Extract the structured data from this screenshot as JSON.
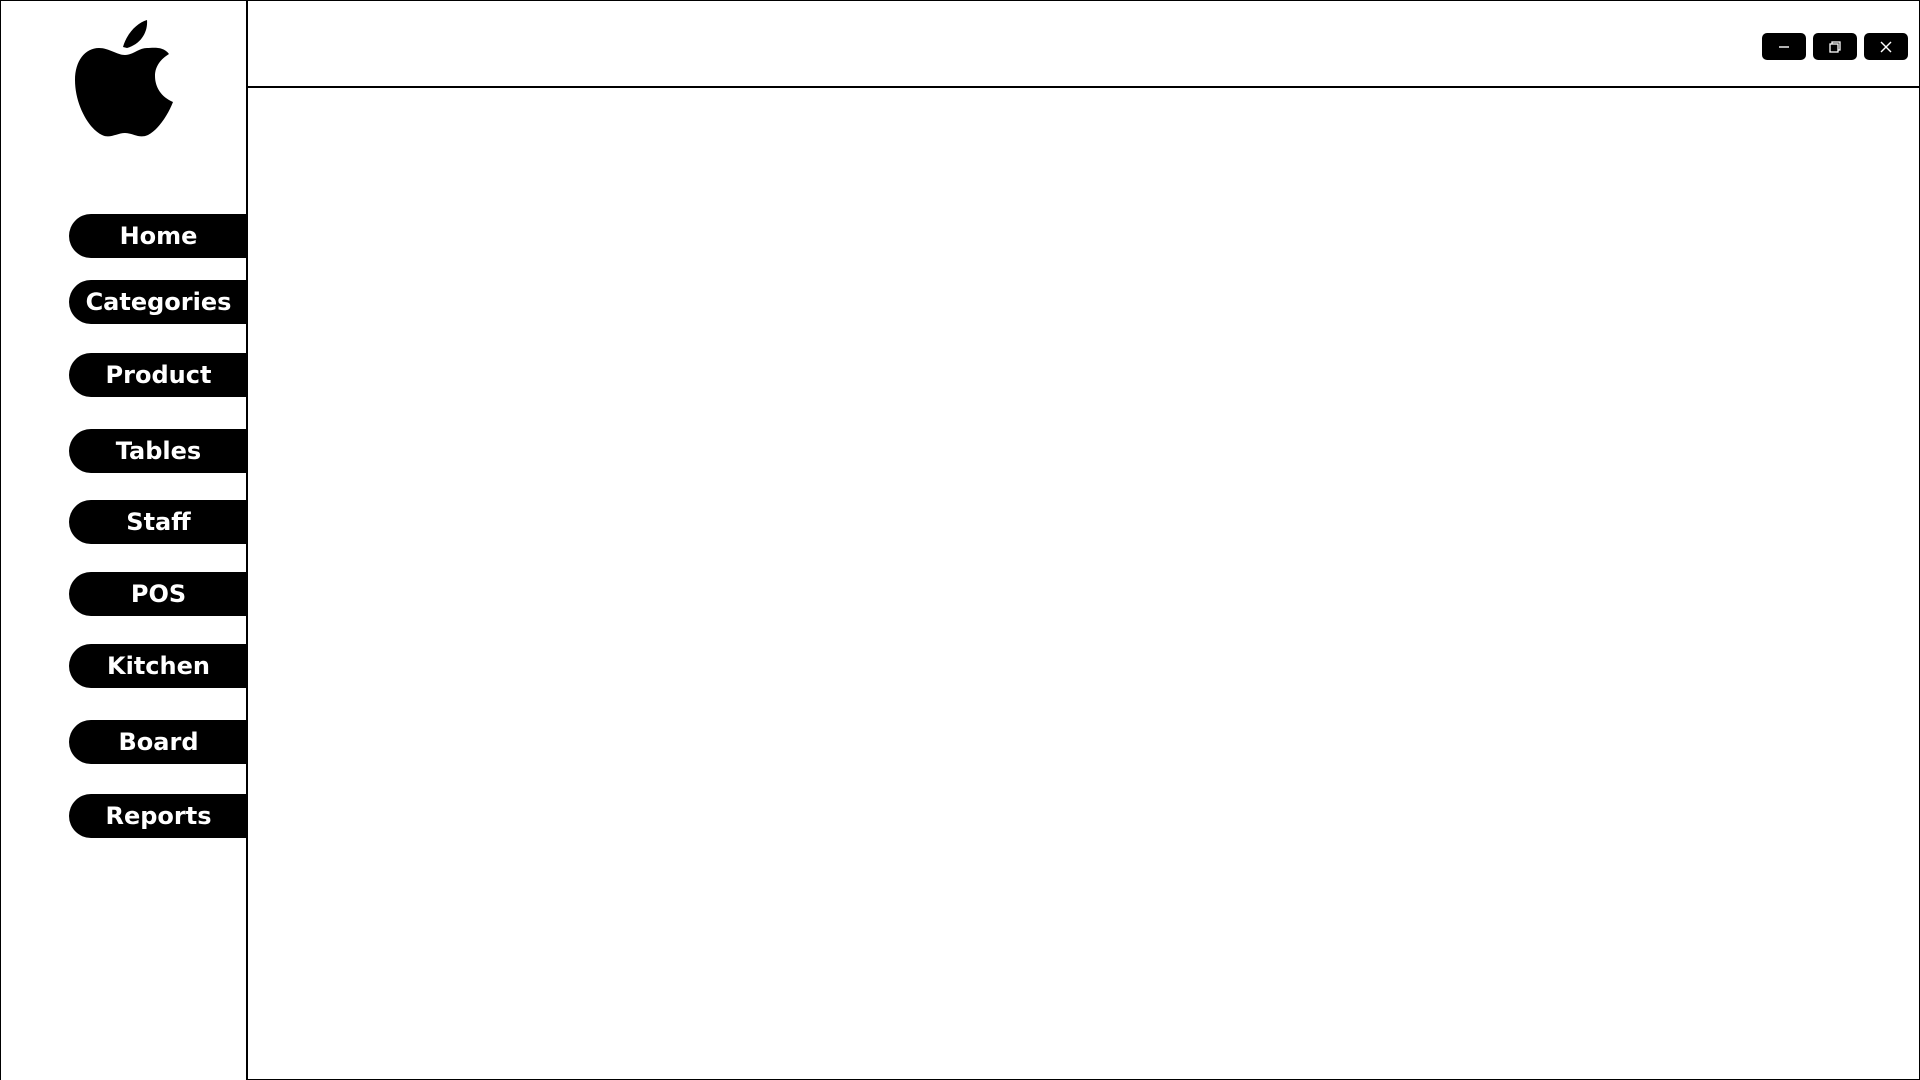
{
  "app": {
    "logo_icon": "apple-logo-icon"
  },
  "sidebar": {
    "items": [
      {
        "label": "Home"
      },
      {
        "label": "Categories"
      },
      {
        "label": "Product"
      },
      {
        "label": "Tables"
      },
      {
        "label": "Staff"
      },
      {
        "label": "POS"
      },
      {
        "label": "Kitchen"
      },
      {
        "label": "Board"
      },
      {
        "label": "Reports"
      }
    ]
  },
  "window_controls": {
    "minimize_icon": "minimize-icon",
    "restore_icon": "restore-icon",
    "close_icon": "close-icon"
  },
  "colors": {
    "background": "#ffffff",
    "button": "#000000",
    "button_text": "#ffffff",
    "border": "#000000"
  }
}
